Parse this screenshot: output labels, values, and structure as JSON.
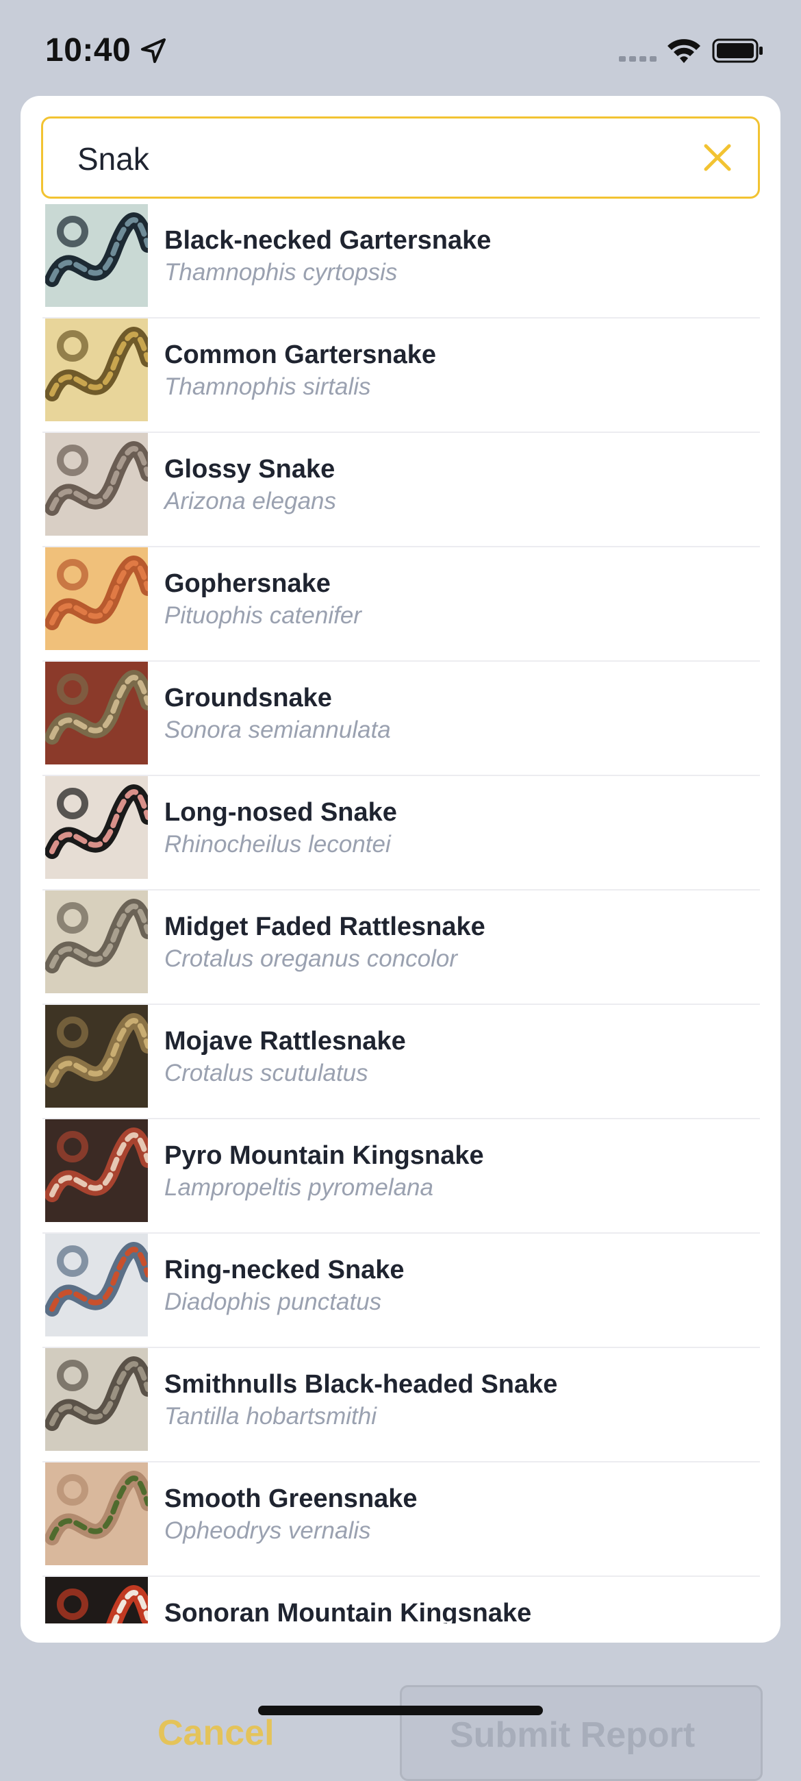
{
  "status_bar": {
    "time": "10:40",
    "icons": [
      "location-arrow-icon",
      "cellular-signal-icon",
      "wifi-icon",
      "battery-icon"
    ]
  },
  "search": {
    "value": "Snak",
    "placeholder": "",
    "clear_icon": "close-icon",
    "accent_color": "#F2C332"
  },
  "results": [
    {
      "common": "Black-necked Gartersnake",
      "scientific": "Thamnophis cyrtopsis"
    },
    {
      "common": "Common Gartersnake",
      "scientific": "Thamnophis sirtalis"
    },
    {
      "common": "Glossy Snake",
      "scientific": "Arizona elegans"
    },
    {
      "common": "Gophersnake",
      "scientific": "Pituophis catenifer"
    },
    {
      "common": "Groundsnake",
      "scientific": "Sonora semiannulata"
    },
    {
      "common": "Long-nosed Snake",
      "scientific": "Rhinocheilus lecontei"
    },
    {
      "common": "Midget Faded Rattlesnake",
      "scientific": "Crotalus oreganus concolor"
    },
    {
      "common": "Mojave Rattlesnake",
      "scientific": "Crotalus scutulatus"
    },
    {
      "common": "Pyro Mountain Kingsnake",
      "scientific": "Lampropeltis pyromelana"
    },
    {
      "common": "Ring-necked Snake",
      "scientific": "Diadophis punctatus"
    },
    {
      "common": "Smithnulls Black-headed Snake",
      "scientific": "Tantilla hobartsmithi"
    },
    {
      "common": "Smooth Greensnake",
      "scientific": "Opheodrys vernalis"
    },
    {
      "common": "Sonoran Mountain Kingsnake",
      "scientific": ""
    }
  ],
  "background": {
    "cancel_label": "Cancel",
    "submit_label": "Submit Report"
  }
}
